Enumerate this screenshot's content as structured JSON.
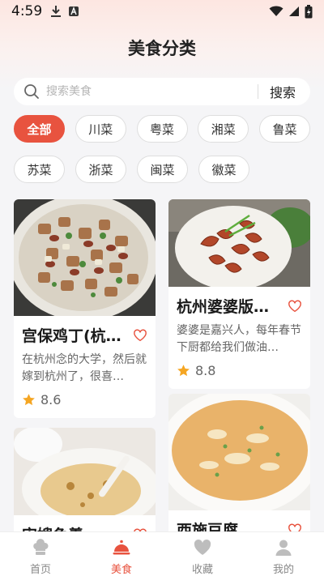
{
  "status": {
    "time": "4:59"
  },
  "header": {
    "title": "美食分类"
  },
  "search": {
    "placeholder": "搜索美食",
    "button_label": "搜索"
  },
  "categories": [
    {
      "label": "全部",
      "active": true
    },
    {
      "label": "川菜"
    },
    {
      "label": "粤菜"
    },
    {
      "label": "湘菜"
    },
    {
      "label": "鲁菜"
    },
    {
      "label": "苏菜"
    },
    {
      "label": "浙菜"
    },
    {
      "label": "闽菜"
    },
    {
      "label": "徽菜"
    }
  ],
  "recipes": [
    {
      "title": "宫保鸡丁(杭…",
      "desc": "在杭州念的大学，然后就嫁到杭州了，很喜…",
      "rating": "8.6"
    },
    {
      "title": "杭州婆婆版…",
      "desc": "婆婆是嘉兴人，每年春节下厨都给我们做油…",
      "rating": "8.8"
    },
    {
      "title": "宋嫂鱼羹"
    },
    {
      "title": "西施豆腐"
    }
  ],
  "tabbar": [
    {
      "label": "首页",
      "icon": "chef-hat-icon"
    },
    {
      "label": "美食",
      "icon": "cloche-icon",
      "active": true
    },
    {
      "label": "收藏",
      "icon": "heart-icon"
    },
    {
      "label": "我的",
      "icon": "user-icon"
    }
  ],
  "colors": {
    "accent": "#e8533f",
    "star": "#f5a623",
    "background": "#f5f5f7"
  }
}
